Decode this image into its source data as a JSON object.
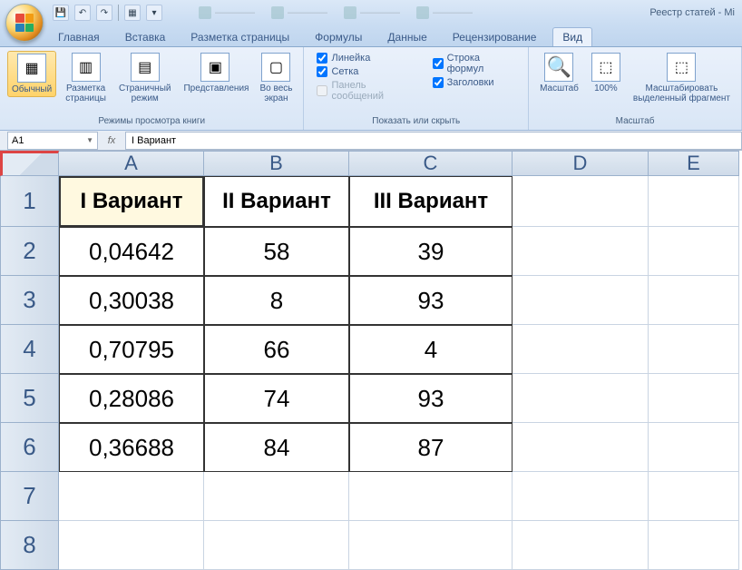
{
  "window_title": "Реестр статей - Mi",
  "qat": {
    "save": "💾",
    "undo": "↶",
    "redo": "↷"
  },
  "tabs": {
    "items": [
      "Главная",
      "Вставка",
      "Разметка страницы",
      "Формулы",
      "Данные",
      "Рецензирование",
      "Вид"
    ],
    "active": "Вид"
  },
  "ribbon": {
    "group_views": {
      "label": "Режимы просмотра книги",
      "normal": "Обычный",
      "page_layout": "Разметка\nстраницы",
      "page_break": "Страничный\nрежим",
      "custom_views": "Представления",
      "fullscreen": "Во весь\nэкран"
    },
    "group_show": {
      "label": "Показать или скрыть",
      "ruler": "Линейка",
      "gridlines": "Сетка",
      "messages": "Панель сообщений",
      "formula_bar": "Строка формул",
      "headings": "Заголовки"
    },
    "group_zoom": {
      "label": "Масштаб",
      "zoom": "Масштаб",
      "pct100": "100%",
      "fit": "Масштабировать\nвыделенный фрагмент"
    }
  },
  "formula_bar": {
    "cell_ref": "A1",
    "fx": "fx",
    "value": "I Вариант"
  },
  "columns": [
    "A",
    "B",
    "C",
    "D",
    "E"
  ],
  "rows": [
    "1",
    "2",
    "3",
    "4",
    "5",
    "6",
    "7",
    "8"
  ],
  "data": {
    "headers": [
      "I Вариант",
      "II Вариант",
      "III Вариант"
    ],
    "r2": [
      "0,04642",
      "58",
      "39"
    ],
    "r3": [
      "0,30038",
      "8",
      "93"
    ],
    "r4": [
      "0,70795",
      "66",
      "4"
    ],
    "r5": [
      "0,28086",
      "74",
      "93"
    ],
    "r6": [
      "0,36688",
      "84",
      "87"
    ]
  }
}
